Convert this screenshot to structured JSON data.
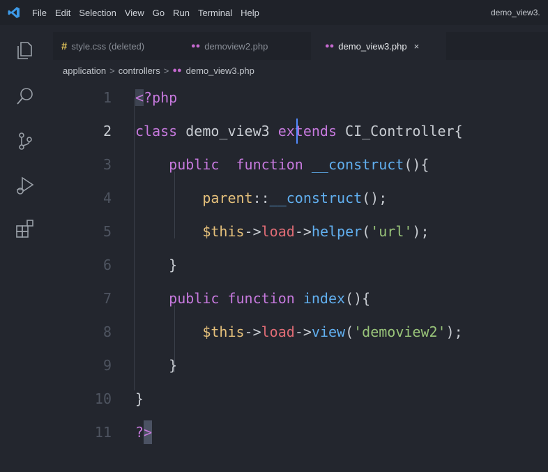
{
  "menubar": {
    "items": [
      "File",
      "Edit",
      "Selection",
      "View",
      "Go",
      "Run",
      "Terminal",
      "Help"
    ],
    "window_title": "demo_view3."
  },
  "tabs": [
    {
      "label": "style.css (deleted)",
      "icon": "hash-icon",
      "active": false
    },
    {
      "label": "demoview2.php",
      "icon": "php-icon",
      "active": false
    },
    {
      "label": "demo_view3.php",
      "icon": "php-icon",
      "active": true,
      "close": "×"
    }
  ],
  "breadcrumb": {
    "items": [
      "application",
      "controllers",
      "demo_view3.php"
    ],
    "separator": ">"
  },
  "editor": {
    "line_numbers": [
      "1",
      "2",
      "3",
      "4",
      "5",
      "6",
      "7",
      "8",
      "9",
      "10",
      "11"
    ],
    "active_line": "2",
    "lines": {
      "l1": {
        "open": "<",
        "rest": "?php"
      },
      "l2": {
        "kw": "class",
        "name": " demo_view3",
        "ext": " extends",
        "base": " CI_Controller{"
      },
      "l3": {
        "indent": "    ",
        "kw1": "public",
        "kw2": "  function",
        "fn": " __construct",
        "rest": "(){"
      },
      "l4": {
        "indent": "        ",
        "kw": "parent",
        "sep": "::",
        "fn": "__construct",
        "rest": "();"
      },
      "l5": {
        "indent": "        ",
        "var": "$this",
        "a1": "->",
        "prop": "load",
        "a2": "->",
        "fn": "helper",
        "p1": "(",
        "str": "'url'",
        "p2": ");"
      },
      "l6": {
        "text": "    }"
      },
      "l7": {
        "indent": "    ",
        "kw1": "public",
        "kw2": " function",
        "fn": " index",
        "rest": "(){"
      },
      "l8": {
        "indent": "        ",
        "var": "$this",
        "a1": "->",
        "prop": "load",
        "a2": "->",
        "fn": "view",
        "p1": "(",
        "str": "'demoview2'",
        "p2": ");"
      },
      "l9": {
        "text": "    }"
      },
      "l10": {
        "text": "}"
      },
      "l11": {
        "q": "?",
        "close": ">"
      }
    }
  },
  "colors": {
    "background": "#23262e",
    "keyword": "#c679dd",
    "function": "#61afef",
    "string": "#98c379",
    "variable": "#e5c07b",
    "property": "#e06c75"
  }
}
